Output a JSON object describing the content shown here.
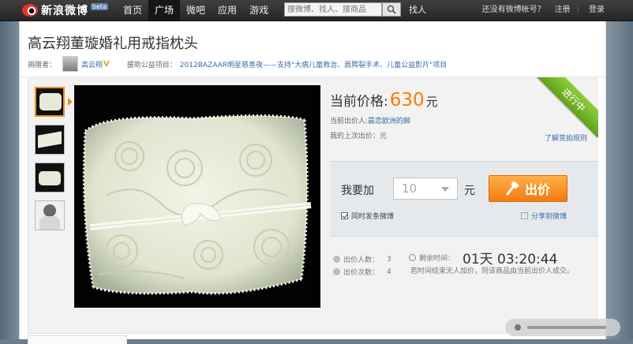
{
  "topbar": {
    "logo_text": "新浪微博",
    "logo_beta": "beta",
    "nav": [
      "首页",
      "广场",
      "微吧",
      "应用",
      "游戏"
    ],
    "search_placeholder": "搜微博、找人、搜商品",
    "find_people": "找人",
    "no_account": "还没有微博帐号？",
    "register": "注册",
    "login": "登录"
  },
  "page": {
    "title": "高云翔董璇婚礼用戒指枕头",
    "donor_label": "捐赠者：",
    "donor_name": "高云翔",
    "donor_badge": "V",
    "project_label": "援助公益项目：",
    "project_name": "2012BAZAAR明星慈善夜——支持\"大病儿童救治、唇腭裂手术、儿童公益影片\"项目"
  },
  "auction": {
    "status": "进行中",
    "price_label": "当前价格:",
    "price_value": "630",
    "price_unit": "元",
    "bidder_label": "当前出价人:",
    "bidder_name": "晨恋欧洲的脚",
    "my_last_label": "我的上次出价：",
    "my_last_value": "元",
    "rules_link": "了解竞拍规则",
    "bid_label": "我要加",
    "bid_amount": "10",
    "bid_unit": "元",
    "bid_button": "出价",
    "sync_label": "同时发条微博",
    "share_label": "分享到微博",
    "bidders_label": "出价人数：",
    "bidders_value": "3",
    "bids_label": "出价次数：",
    "bids_value": "4",
    "remaining_label": "剩余时间：",
    "remaining_value": "01天  03:20:44",
    "note": "若时间结束无人加价，则该商品由当前出价人成交。"
  },
  "colors": {
    "accent_orange": "#ff7a00",
    "status_green": "#6cb52a",
    "link_blue": "#3a6aa6"
  }
}
